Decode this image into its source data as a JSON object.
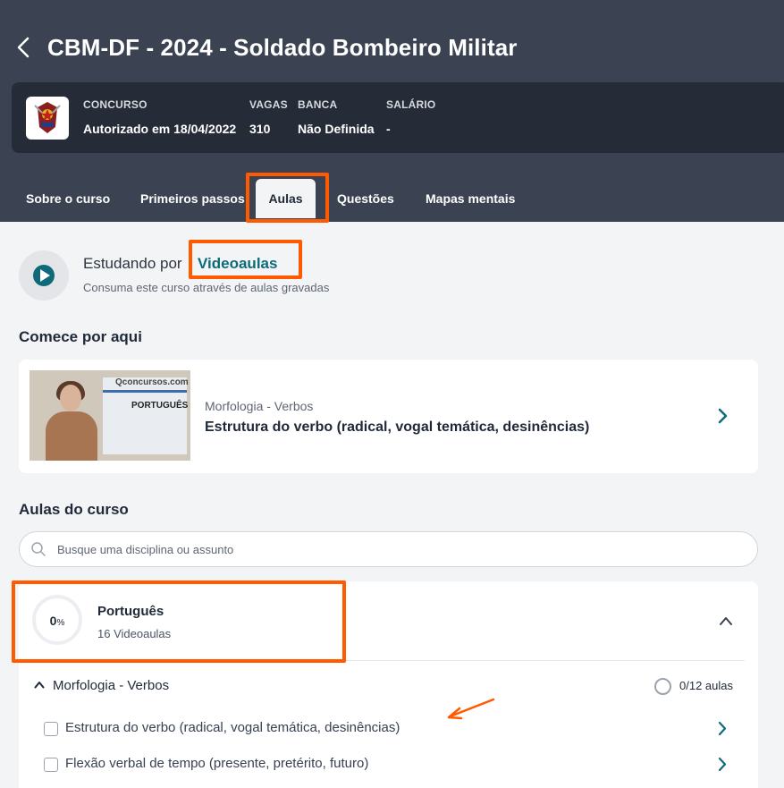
{
  "header": {
    "title": "CBM-DF - 2024 - Soldado Bombeiro Militar",
    "info": {
      "concurso_label": "CONCURSO",
      "concurso_value": "Autorizado em 18/04/2022",
      "vagas_label": "VAGAS",
      "vagas_value": "310",
      "banca_label": "BANCA",
      "banca_value": "Não Definida",
      "salario_label": "SALÁRIO",
      "salario_value": "-"
    }
  },
  "tabs": [
    {
      "label": "Sobre o curso"
    },
    {
      "label": "Primeiros passos"
    },
    {
      "label": "Aulas",
      "active": true
    },
    {
      "label": "Questões"
    },
    {
      "label": "Mapas mentais"
    }
  ],
  "study": {
    "prefix": "Estudando por",
    "mode": "Videoaulas",
    "subtitle": "Consuma este curso através de aulas gravadas"
  },
  "start_here": {
    "heading": "Comece por aqui",
    "thumbnail": {
      "brand": "Qconcursos.com",
      "slide_title": "PORTUGUÊS"
    },
    "subject": "Morfologia - Verbos",
    "lesson": "Estrutura do verbo (radical, vogal temática, desinências)"
  },
  "course_lessons": {
    "heading": "Aulas do curso",
    "search_placeholder": "Busque uma disciplina ou assunto",
    "discipline": {
      "progress": "0",
      "progress_unit": "%",
      "name": "Português",
      "count": "16 Videoaulas",
      "module": {
        "name": "Morfologia - Verbos",
        "progress": "0/12 aulas",
        "lessons": [
          {
            "title": "Estrutura do verbo (radical, vogal temática, desinências)"
          },
          {
            "title": "Flexão verbal de tempo (presente, pretérito, futuro)"
          }
        ]
      }
    }
  },
  "colors": {
    "header_bg": "#3b4252",
    "info_card_bg": "#262c37",
    "accent_teal": "#0e6a7a",
    "annotation_orange": "#ff5a00"
  }
}
